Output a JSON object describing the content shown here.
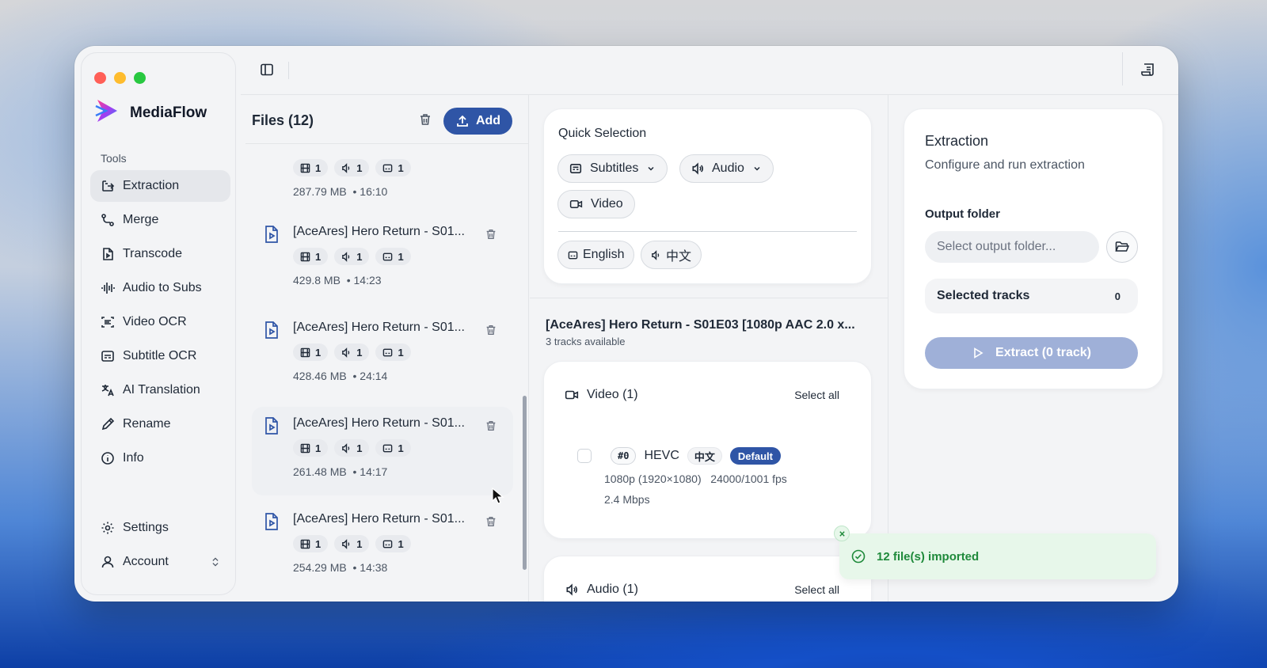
{
  "app": {
    "name": "MediaFlow"
  },
  "sidebar": {
    "section_label": "Tools",
    "items": [
      {
        "label": "Extraction",
        "icon": "extraction-icon",
        "active": true
      },
      {
        "label": "Merge",
        "icon": "merge-icon"
      },
      {
        "label": "Transcode",
        "icon": "transcode-icon"
      },
      {
        "label": "Audio to Subs",
        "icon": "waveform-icon"
      },
      {
        "label": "Video OCR",
        "icon": "scan-icon"
      },
      {
        "label": "Subtitle OCR",
        "icon": "subtitle-icon"
      },
      {
        "label": "AI Translation",
        "icon": "translate-icon"
      },
      {
        "label": "Rename",
        "icon": "pen-icon"
      },
      {
        "label": "Info",
        "icon": "info-icon"
      }
    ],
    "settings_label": "Settings",
    "account_label": "Account"
  },
  "files": {
    "title": "Files (12)",
    "add_label": "Add",
    "items": [
      {
        "name": "",
        "video": "1",
        "audio": "1",
        "subs": "1",
        "size": "287.79 MB",
        "duration": "16:10"
      },
      {
        "name": "[AceAres] Hero Return - S01...",
        "video": "1",
        "audio": "1",
        "subs": "1",
        "size": "429.8 MB",
        "duration": "14:23"
      },
      {
        "name": "[AceAres] Hero Return - S01...",
        "video": "1",
        "audio": "1",
        "subs": "1",
        "size": "428.46 MB",
        "duration": "24:14"
      },
      {
        "name": "[AceAres] Hero Return - S01...",
        "video": "1",
        "audio": "1",
        "subs": "1",
        "size": "261.48 MB",
        "duration": "14:17"
      },
      {
        "name": "[AceAres] Hero Return - S01...",
        "video": "1",
        "audio": "1",
        "subs": "1",
        "size": "254.29 MB",
        "duration": "14:38"
      }
    ]
  },
  "quick_selection": {
    "title": "Quick Selection",
    "subtitles_label": "Subtitles",
    "audio_label": "Audio",
    "video_label": "Video",
    "lang_english": "English",
    "lang_chinese": "中文"
  },
  "detail": {
    "file_name": "[AceAres] Hero Return - S01E03 [1080p AAC 2.0 x...",
    "tracks_available": "3 tracks available",
    "video_section": {
      "title": "Video (1)",
      "select_all": "Select all",
      "track": {
        "index": "#0",
        "codec": "HEVC",
        "language": "中文",
        "default_label": "Default",
        "resolution": "1080p (1920×1080)",
        "fps": "24000/1001 fps",
        "bitrate": "2.4 Mbps"
      }
    },
    "audio_section": {
      "title": "Audio (1)",
      "select_all": "Select all"
    }
  },
  "extraction": {
    "title": "Extraction",
    "subtitle": "Configure and run extraction",
    "output_label": "Output folder",
    "output_placeholder": "Select output folder...",
    "selected_tracks_label": "Selected tracks",
    "selected_tracks_count": "0",
    "extract_label": "Extract (0 track)"
  },
  "toast": {
    "message": "12 file(s) imported"
  },
  "colors": {
    "accent": "#2f55a6",
    "toast_bg": "#e7f7ea",
    "toast_text": "#1f8a3b"
  }
}
